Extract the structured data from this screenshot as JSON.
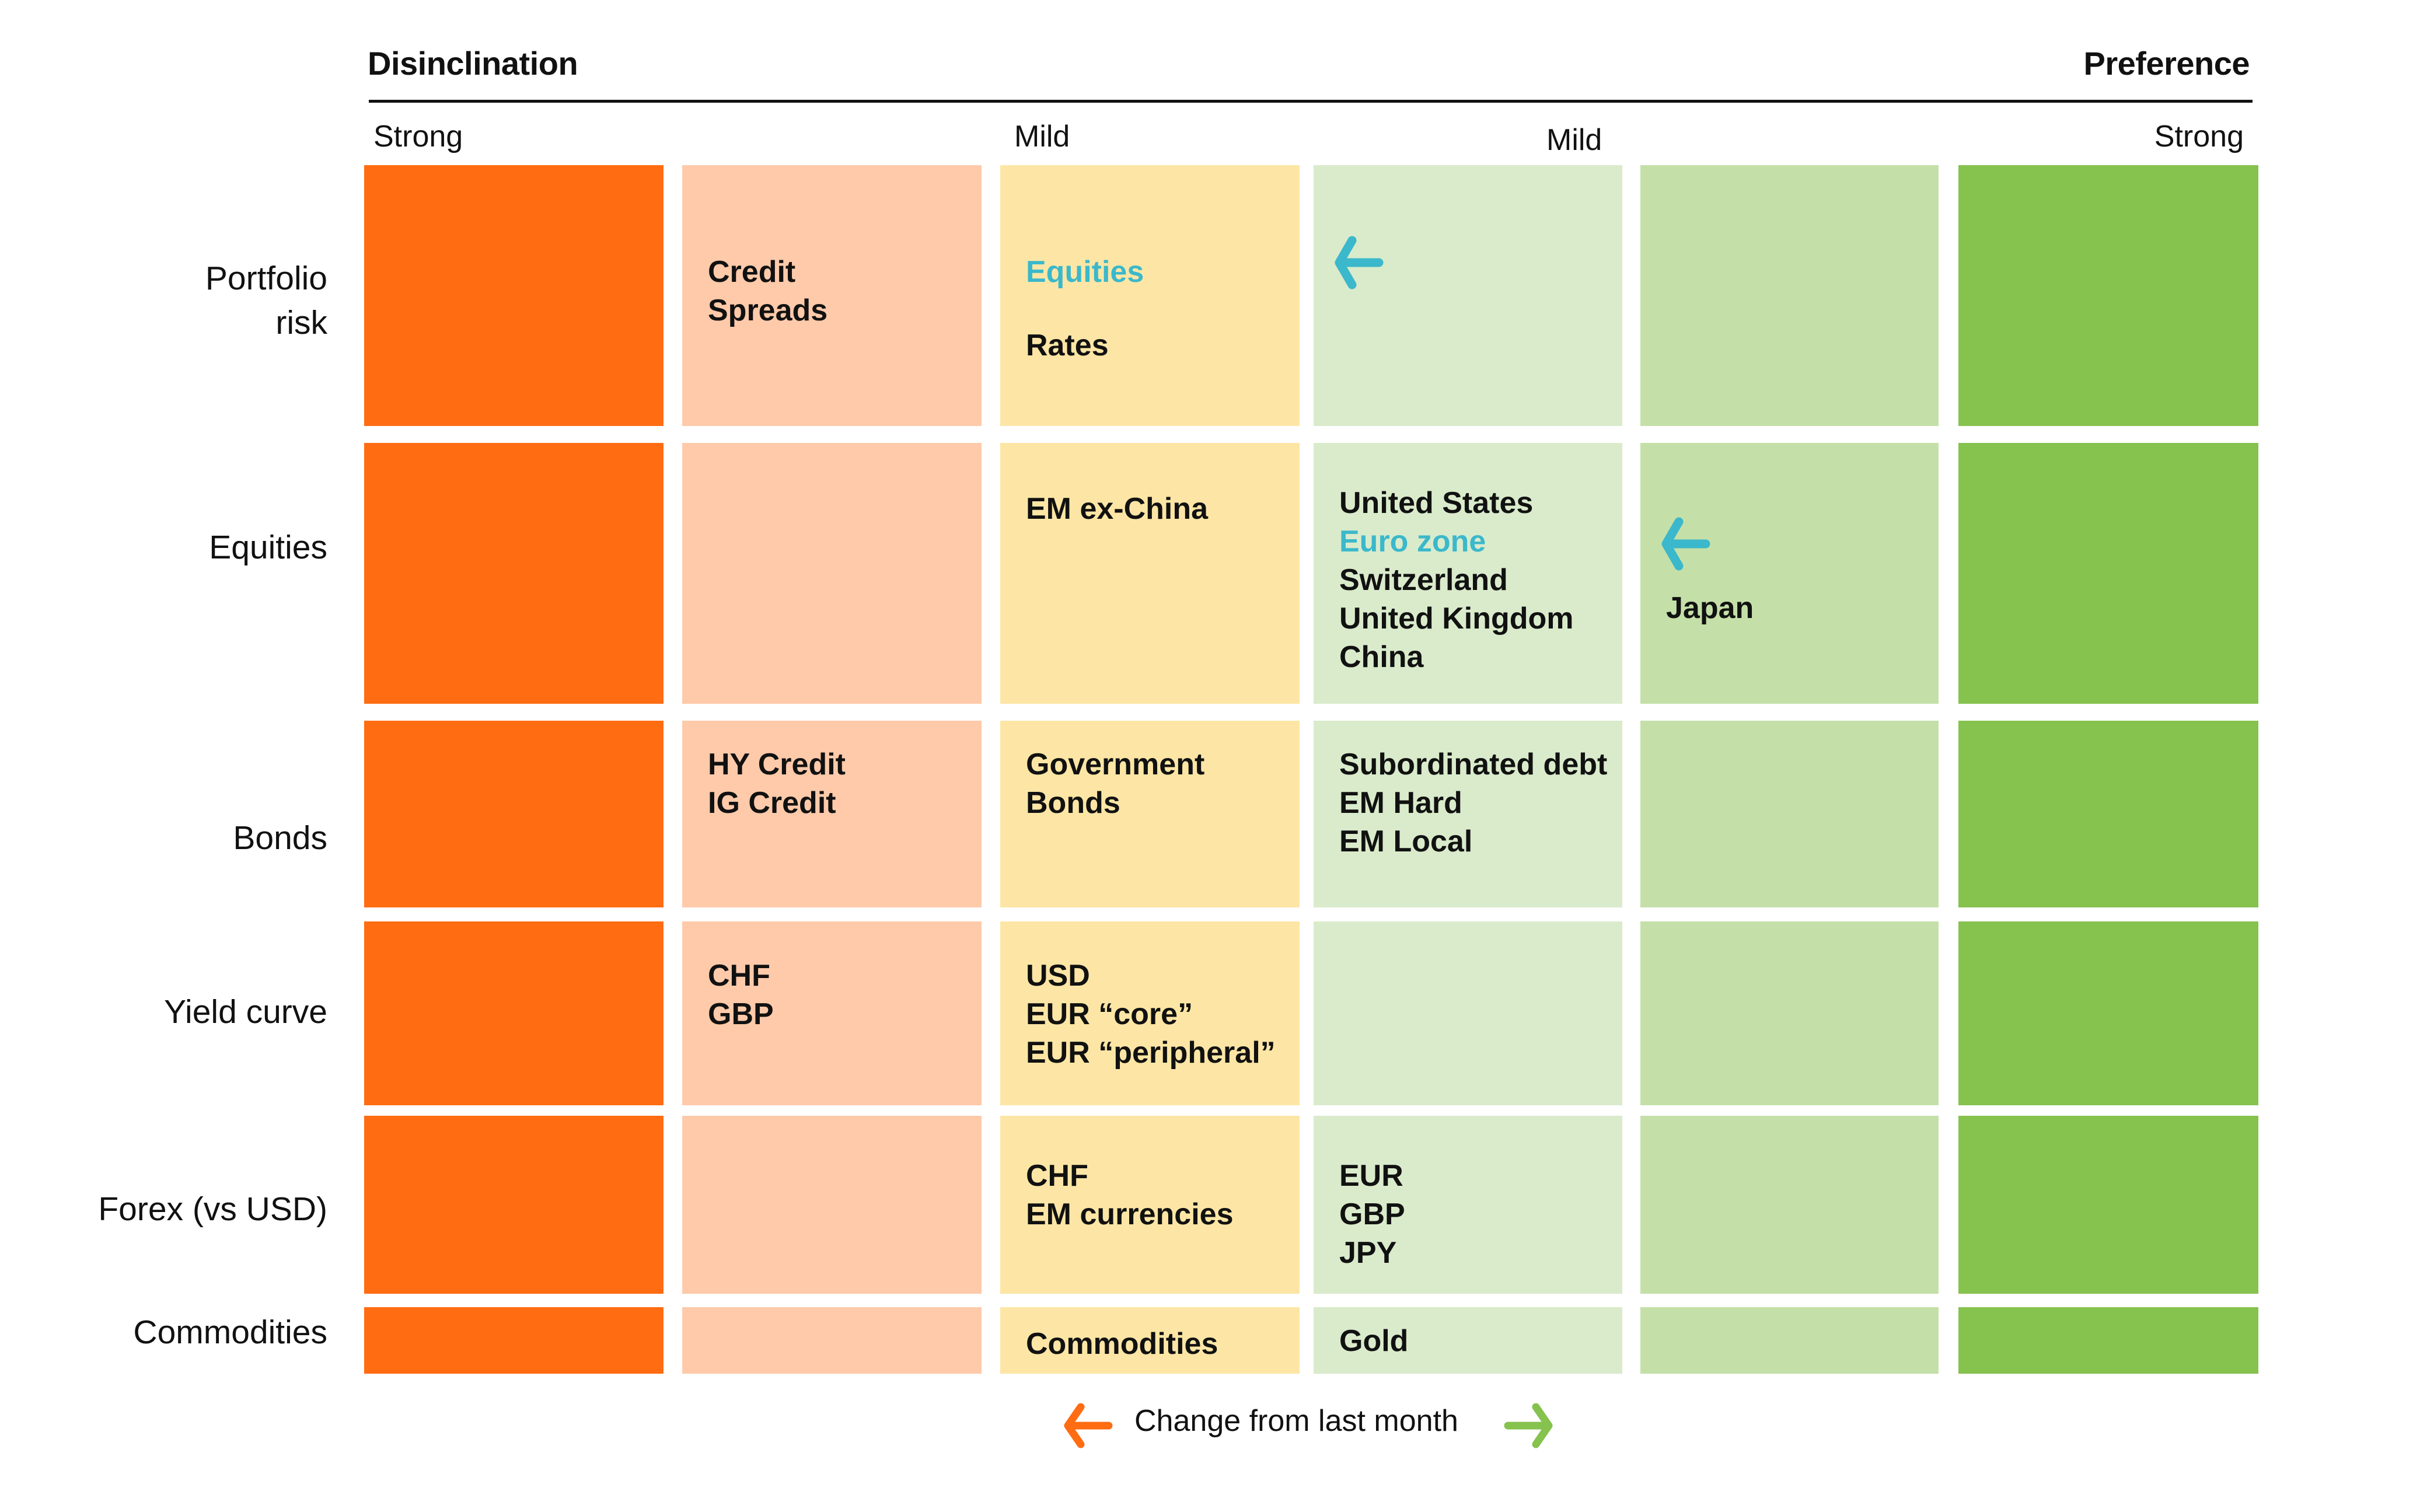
{
  "header": {
    "left_title": "Disinclination",
    "right_title": "Preference"
  },
  "scale_labels": {
    "strong_left": "Strong",
    "mild_left": "Mild",
    "mild_right": "Mild",
    "strong_right": "Strong"
  },
  "colors": {
    "strong_disinclination": "#FF6C12",
    "disinclination": "#FECAAA",
    "mild_disinclination": "#FDE6A5",
    "mild_preference": "#D9EBCB",
    "preference": "#C4E0A8",
    "strong_preference": "#86C24E",
    "change_highlight": "#3BB8CB",
    "legend_left_arrow": "#FF6C12",
    "legend_right_arrow": "#86C24E"
  },
  "rows": [
    {
      "label": "Portfolio risk",
      "label_lines": [
        "Portfolio",
        "risk"
      ],
      "cells": [
        [],
        [
          "Credit",
          "Spreads"
        ],
        [
          "Equities",
          "Rates"
        ],
        [],
        [],
        []
      ],
      "highlighted": [
        "Equities"
      ],
      "change_arrow": {
        "column": 4,
        "direction": "left",
        "icon": "arrow-left-icon"
      }
    },
    {
      "label": "Equities",
      "label_lines": [
        "Equities"
      ],
      "cells": [
        [],
        [],
        [
          "EM ex-China"
        ],
        [
          "United States",
          "Euro zone",
          "Switzerland",
          "United Kingdom",
          "China"
        ],
        [
          "Japan"
        ],
        []
      ],
      "highlighted": [
        "Euro zone"
      ],
      "change_arrow": {
        "column": 5,
        "direction": "left",
        "icon": "arrow-left-icon"
      }
    },
    {
      "label": "Bonds",
      "label_lines": [
        "Bonds"
      ],
      "cells": [
        [],
        [
          "HY Credit",
          "IG Credit"
        ],
        [
          "Government",
          "Bonds"
        ],
        [
          "Subordinated debt",
          "EM Hard",
          "EM Local"
        ],
        [],
        []
      ]
    },
    {
      "label": "Yield curve",
      "label_lines": [
        "Yield curve"
      ],
      "cells": [
        [],
        [
          "CHF",
          "GBP"
        ],
        [
          "USD",
          "EUR “core”",
          "EUR “peripheral”"
        ],
        [],
        [],
        []
      ]
    },
    {
      "label": "Forex (vs USD)",
      "label_lines": [
        "Forex (vs USD)"
      ],
      "cells": [
        [],
        [],
        [
          "CHF",
          "EM currencies"
        ],
        [
          "EUR",
          "GBP",
          "JPY"
        ],
        [],
        []
      ]
    },
    {
      "label": "Commodities",
      "label_lines": [
        "Commodities"
      ],
      "cells": [
        [],
        [],
        [
          "Commodities"
        ],
        [
          "Gold"
        ],
        [],
        []
      ]
    }
  ],
  "legend": {
    "text": "Change from last month",
    "left_icon": "arrow-left-icon",
    "right_icon": "arrow-right-icon"
  }
}
